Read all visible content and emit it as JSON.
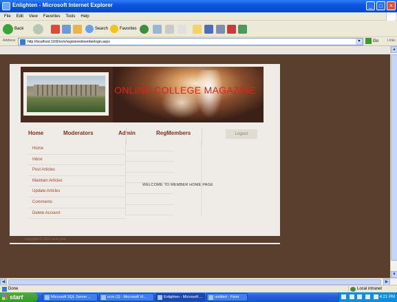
{
  "window": {
    "title": "Enlighten - Microsoft Internet Explorer",
    "minimize": "_",
    "maximize": "□",
    "close": "×"
  },
  "menu": [
    "File",
    "Edit",
    "View",
    "Favorites",
    "Tools",
    "Help"
  ],
  "toolbar": {
    "back": "Back",
    "search": "Search",
    "favorites": "Favorites"
  },
  "address": {
    "label": "Address",
    "url": "http://localhost:1165/ocm/registeredmemberlogin.aspx",
    "go": "Go",
    "links": "Links"
  },
  "page": {
    "magazine_title": "ONLINE COLLEGE MAGAZINE",
    "nav": [
      "Home",
      "Moderators",
      "Admin",
      "RegMembers"
    ],
    "logout": "Logout",
    "sidebar": [
      "Home",
      "Inbox",
      "Post Articles",
      "Maintain Articles",
      "Update Articles",
      "Comments",
      "Delete Account"
    ],
    "welcome": "WELCOME TO MEMBER HOME PAGE",
    "footer": "copyright © 2010 ocm.com"
  },
  "status": {
    "text": "Done",
    "zone": "Local intranet"
  },
  "taskbar": {
    "start": "start",
    "tasks": [
      "Microsoft SQL Server ...",
      "ocm (2) - Microsoft Vi...",
      "Enlighten - Microsoft ...",
      "untitled - Paint"
    ],
    "clock": "4:21 PM"
  }
}
